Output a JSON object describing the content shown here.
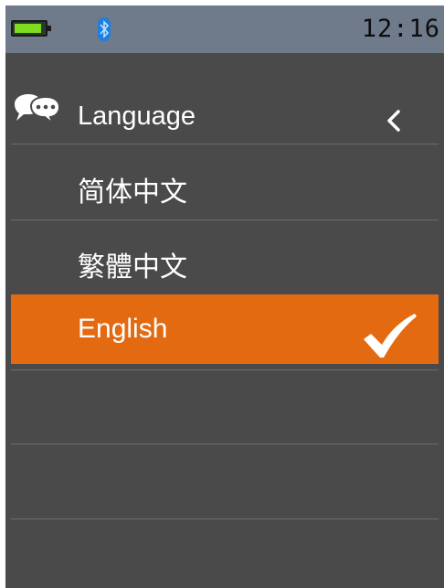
{
  "status_bar": {
    "time": "12:16",
    "battery_level": 0.9,
    "battery_color": "#7ddc1f",
    "bluetooth_icon": "bluetooth-icon",
    "bluetooth_color": "#1e7fe0"
  },
  "header": {
    "icon": "chat-bubble-icon",
    "title": "Language",
    "back_icon": "chevron-left-icon"
  },
  "languages": [
    {
      "label": "简体中文",
      "selected": false
    },
    {
      "label": "繁體中文",
      "selected": false
    },
    {
      "label": "English",
      "selected": true
    }
  ],
  "colors": {
    "background": "#4a4a4a",
    "status_bar": "#6f7b8b",
    "selected": "#e46a12",
    "text": "#ffffff"
  }
}
